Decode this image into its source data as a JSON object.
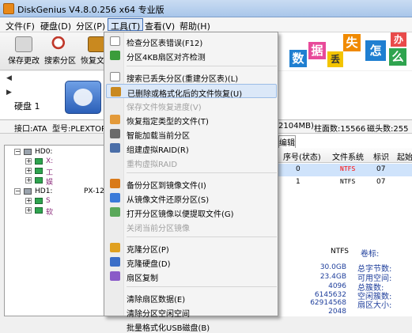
{
  "window": {
    "title": "DiskGenius V4.8.0.256 x64 专业版"
  },
  "menubar": [
    "文件(F)",
    "硬盘(D)",
    "分区(P)",
    "工具(T)",
    "查看(V)",
    "帮助(H)"
  ],
  "toolbar": [
    "保存更改",
    "搜索分区",
    "恢复文件"
  ],
  "banner": {
    "tiles": [
      "数",
      "据",
      "丢",
      "失",
      "怎",
      "么",
      "办"
    ]
  },
  "disk": {
    "label": "硬盘 1"
  },
  "infobar": {
    "interface": "接口:ATA",
    "model": "型号:PLEXTORPX",
    "capacity": "2104MB)",
    "cylinders": "柱面数:15566",
    "heads": "磁头数:255"
  },
  "tree": [
    {
      "text": "HD0:"
    },
    {
      "text": "X:"
    },
    {
      "text": "工"
    },
    {
      "text": "娱"
    },
    {
      "text": "HD1:"
    },
    {
      "text": "PX-12"
    },
    {
      "text": "S"
    },
    {
      "text": "软"
    }
  ],
  "right": {
    "tab": "编辑",
    "columns": [
      "序号(状态)",
      "文件系统",
      "标识",
      "起始"
    ],
    "rows": [
      {
        "index": "0",
        "fs": "NTFS",
        "id": "07"
      },
      {
        "index": "1",
        "fs": "NTFS",
        "id": "07"
      }
    ],
    "details": {
      "fs_value": "NTFS",
      "volume_label": "卷标:",
      "values": [
        "30.0GB",
        "23.4GB",
        "4096",
        "6145632",
        "62914568",
        "2048"
      ],
      "labels": [
        "总字节数:",
        "可用空间:",
        "总簇数:",
        "空闲簇数:",
        "扇区大小:"
      ]
    }
  },
  "tools_menu": {
    "groups": [
      [
        {
          "label": "检查分区表错误(F12)",
          "disabled": false,
          "icon": "check-icon",
          "color": "#ffffff"
        },
        {
          "label": "分区4KB扇区对齐检测",
          "disabled": false,
          "icon": "align-icon",
          "color": "#3a9c3a"
        }
      ],
      [
        {
          "label": "搜索已丢失分区(重建分区表)(L)",
          "disabled": false,
          "icon": "search-icon",
          "color": "#ffffff"
        },
        {
          "label": "已删除或格式化后的文件恢复(U)",
          "disabled": false,
          "icon": "recover-icon",
          "color": "#c9891f"
        },
        {
          "label": "保存文件恢复进度(V)",
          "disabled": true,
          "icon": "",
          "color": ""
        },
        {
          "label": "恢复指定类型的文件(T)",
          "disabled": false,
          "icon": "filetype-icon",
          "color": "#e39a3a"
        },
        {
          "label": "智能加载当前分区",
          "disabled": false,
          "icon": "smart-load-icon",
          "color": "#6b6b6b"
        },
        {
          "label": "组建虚拟RAID(R)",
          "disabled": false,
          "icon": "raid-icon",
          "color": "#4a6ea8"
        },
        {
          "label": "重构虚拟RAID",
          "disabled": true,
          "icon": "",
          "color": ""
        }
      ],
      [
        {
          "label": "备份分区到镜像文件(I)",
          "disabled": false,
          "icon": "backup-icon",
          "color": "#d97a1a"
        },
        {
          "label": "从镜像文件还原分区(S)",
          "disabled": false,
          "icon": "restore-icon",
          "color": "#3a7ad9"
        },
        {
          "label": "打开分区镜像以便提取文件(G)",
          "disabled": false,
          "icon": "open-image-icon",
          "color": "#5aa85a"
        },
        {
          "label": "关闭当前分区镜像",
          "disabled": true,
          "icon": "",
          "color": ""
        }
      ],
      [
        {
          "label": "克隆分区(P)",
          "disabled": false,
          "icon": "clone-partition-icon",
          "color": "#e0a020"
        },
        {
          "label": "克隆硬盘(D)",
          "disabled": false,
          "icon": "clone-disk-icon",
          "color": "#3a6ec8"
        },
        {
          "label": "扇区复制",
          "disabled": false,
          "icon": "sector-copy-icon",
          "color": "#8a5ac8"
        }
      ],
      [
        {
          "label": "清除扇区数据(E)",
          "disabled": false,
          "icon": "",
          "color": ""
        },
        {
          "label": "清除分区空闲空间",
          "disabled": false,
          "icon": "",
          "color": ""
        },
        {
          "label": "批量格式化USB磁盘(B)",
          "disabled": false,
          "icon": "",
          "color": ""
        }
      ]
    ]
  }
}
